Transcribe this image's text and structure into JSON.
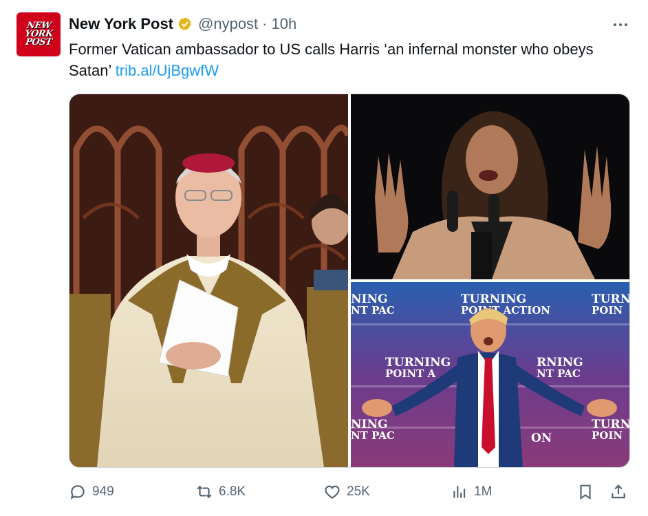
{
  "account": {
    "avatar_lines": [
      "NEW",
      "YORK",
      "POST"
    ],
    "display_name": "New York Post",
    "handle": "@nypost",
    "separator": "·",
    "time": "10h",
    "verified_color": "#e2b719"
  },
  "tweet": {
    "text": "Former Vatican ambassador to US calls Harris ‘an infernal monster who obeys Satan’ ",
    "link": "trib.al/UjBgwfW"
  },
  "media": {
    "photos": [
      {
        "subject": "archbishop-photo"
      },
      {
        "subject": "harris-speaking-photo"
      },
      {
        "subject": "trump-rally-photo"
      }
    ],
    "backdrop_text": {
      "top_left": "NING",
      "top_left_sub": "NT PAC",
      "top_center": "TURNING",
      "top_center_sub": "POINT ACTION",
      "top_right": "TURN",
      "top_right_sub": "POIN",
      "mid_left": "TURNING",
      "mid_left_sub": "POINT A",
      "mid_right": "RNING",
      "mid_right_sub": "NT PAC",
      "low_left": "NING",
      "low_left_sub": "NT PAC",
      "low_center": "ON",
      "low_right": "TURN",
      "low_right_sub": "POIN"
    }
  },
  "metrics": {
    "replies": "949",
    "reposts": "6.8K",
    "likes": "25K",
    "views": "1M"
  },
  "colors": {
    "accent_link": "#1d9bf0",
    "brand_red": "#d0021b",
    "muted": "#536471"
  },
  "icons": [
    "reply-icon",
    "repost-icon",
    "like-icon",
    "views-icon",
    "bookmark-icon",
    "share-icon",
    "more-icon",
    "verified-badge-icon"
  ]
}
